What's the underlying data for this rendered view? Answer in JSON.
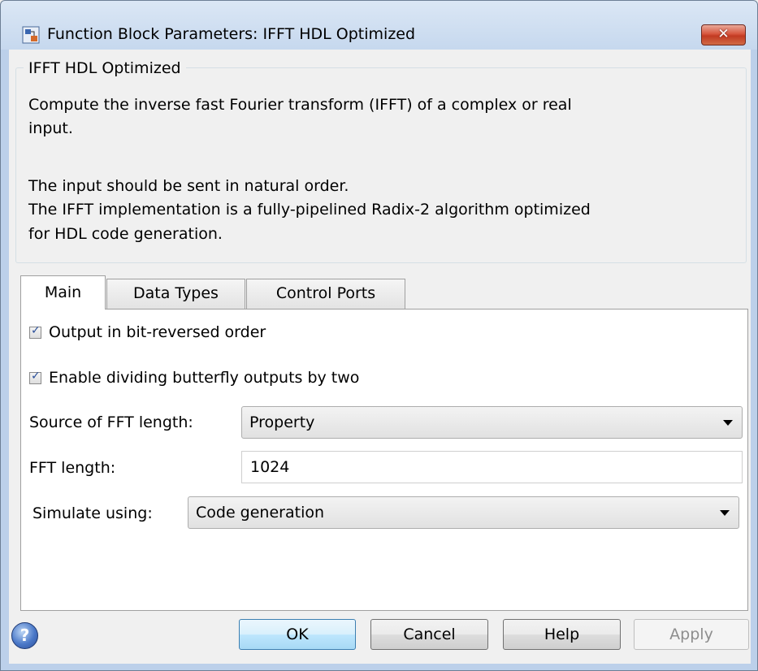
{
  "window": {
    "title": "Function Block Parameters: IFFT HDL Optimized",
    "close_glyph": "✕"
  },
  "description": {
    "group_title": "IFFT HDL Optimized",
    "lines": [
      "Compute the inverse fast Fourier transform (IFFT) of a complex or real",
      "input.",
      "The input should be sent in natural order.",
      "The IFFT implementation is a fully-pipelined Radix-2 algorithm optimized",
      "for HDL code generation."
    ]
  },
  "tabs": [
    {
      "label": "Main",
      "active": true
    },
    {
      "label": "Data Types",
      "active": false
    },
    {
      "label": "Control Ports",
      "active": false
    }
  ],
  "main": {
    "output_bitreversed": {
      "label": "Output in bit-reversed order",
      "checked": true
    },
    "divide_butterfly": {
      "label": "Enable dividing butterfly outputs by two",
      "checked": true
    },
    "source_fft_length": {
      "label": "Source of FFT length:",
      "value": "Property"
    },
    "fft_length": {
      "label": "FFT length:",
      "value": "1024"
    },
    "simulate_using": {
      "label": "Simulate using:",
      "value": "Code generation"
    }
  },
  "buttons": {
    "ok": "OK",
    "cancel": "Cancel",
    "help": "Help",
    "apply": "Apply",
    "help_icon_glyph": "?"
  }
}
